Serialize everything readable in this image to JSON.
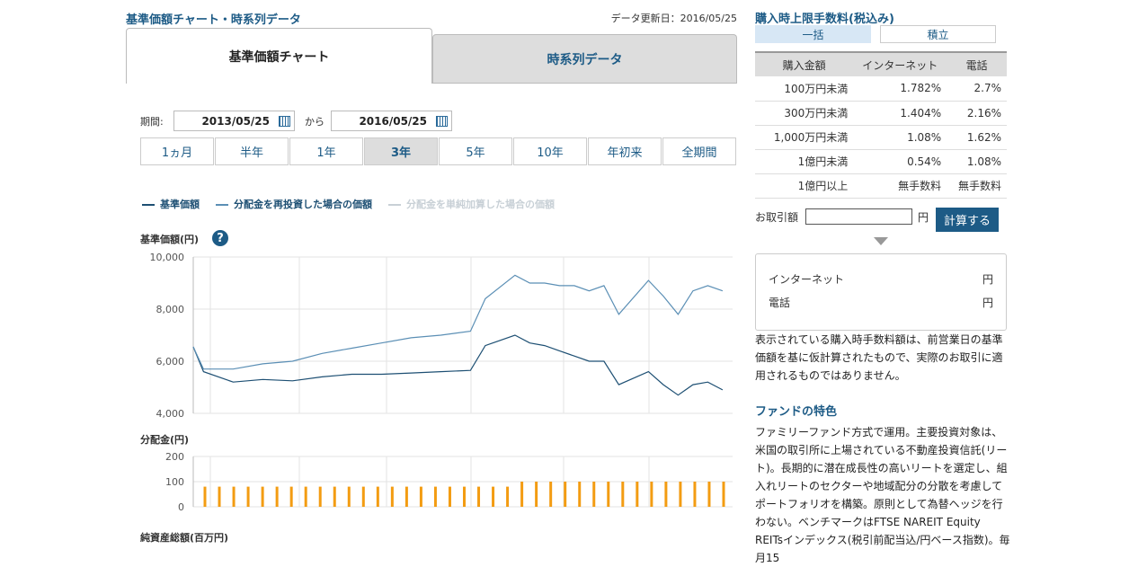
{
  "left": {
    "title": "基準価額チャート・時系列データ",
    "updated": "データ更新日：2016/05/25",
    "tabs": [
      {
        "label": "基準価額チャート"
      },
      {
        "label": "時系列データ"
      }
    ],
    "period_label": "期間:",
    "from_date": "2013/05/25",
    "to_label": "から",
    "to_date": "2016/05/25",
    "periods": [
      "1ヵ月",
      "半年",
      "1年",
      "3年",
      "5年",
      "10年",
      "年初来",
      "全期間"
    ],
    "selected_period": "3年",
    "legend": [
      "基準価額",
      "分配金を再投資した場合の価額",
      "分配金を単純加算した場合の価額"
    ],
    "price_axis_title": "基準価額(円)",
    "help_icon": "?",
    "dist_axis_title": "分配金(円)",
    "bottom_title": "純資産総額(百万円)"
  },
  "colors": {
    "nav": "#1d4f73",
    "reinvest": "#5b8fb5",
    "simple": "#c8d0d6",
    "bar": "#f39c12",
    "accent": "#1d5b86"
  },
  "chart_data": [
    {
      "type": "line",
      "title": "",
      "ylabel": "基準価額(円)",
      "ylim": [
        4000,
        10000
      ],
      "yticks": [
        "10,000",
        "8,000",
        "6,000",
        "4,000"
      ],
      "x_range": [
        "2013/05/25",
        "2016/05/25"
      ],
      "series": [
        {
          "name": "基準価額",
          "x": [
            "2013/05",
            "2013/06",
            "2013/08",
            "2013/10",
            "2013/12",
            "2014/02",
            "2014/04",
            "2014/06",
            "2014/08",
            "2014/10",
            "2014/12",
            "2015/01",
            "2015/03",
            "2015/04",
            "2015/05",
            "2015/06",
            "2015/07",
            "2015/08",
            "2015/09",
            "2015/10",
            "2015/12",
            "2016/01",
            "2016/02",
            "2016/03",
            "2016/04",
            "2016/05"
          ],
          "values": [
            6550,
            5600,
            5200,
            5300,
            5250,
            5400,
            5500,
            5500,
            5550,
            5600,
            5650,
            6600,
            7000,
            6700,
            6600,
            6400,
            6200,
            6000,
            6000,
            5100,
            5600,
            5100,
            4700,
            5100,
            5200,
            4900
          ]
        },
        {
          "name": "分配金を再投資した場合の価額",
          "x": [
            "2013/05",
            "2013/06",
            "2013/08",
            "2013/10",
            "2013/12",
            "2014/02",
            "2014/04",
            "2014/06",
            "2014/08",
            "2014/10",
            "2014/12",
            "2015/01",
            "2015/03",
            "2015/04",
            "2015/05",
            "2015/06",
            "2015/07",
            "2015/08",
            "2015/09",
            "2015/10",
            "2015/12",
            "2016/01",
            "2016/02",
            "2016/03",
            "2016/04",
            "2016/05"
          ],
          "values": [
            6550,
            5700,
            5700,
            5900,
            6000,
            6300,
            6500,
            6700,
            6900,
            7000,
            7150,
            8400,
            9300,
            9000,
            9000,
            8900,
            8900,
            8700,
            8900,
            7800,
            9100,
            8500,
            7800,
            8700,
            8900,
            8700
          ]
        }
      ]
    },
    {
      "type": "bar",
      "title": "",
      "ylabel": "分配金(円)",
      "ylim": [
        0,
        200
      ],
      "yticks": [
        "200",
        "100",
        "0"
      ],
      "values": [
        80,
        80,
        80,
        80,
        80,
        80,
        80,
        80,
        80,
        80,
        80,
        80,
        80,
        80,
        80,
        80,
        80,
        80,
        80,
        80,
        80,
        80,
        100,
        100,
        100,
        100,
        100,
        100,
        100,
        100,
        100,
        100,
        100,
        100,
        100,
        100,
        100
      ]
    }
  ],
  "right": {
    "title": "購入時上限手数料(税込み)",
    "tabs": [
      "一括",
      "積立"
    ],
    "table": {
      "headers": [
        "購入金額",
        "インターネット",
        "電話"
      ],
      "rows": [
        [
          "100万円未満",
          "1.782%",
          "2.7%"
        ],
        [
          "300万円未満",
          "1.404%",
          "2.16%"
        ],
        [
          "1,000万円未満",
          "1.08%",
          "1.62%"
        ],
        [
          "1億円未満",
          "0.54%",
          "1.08%"
        ],
        [
          "1億円以上",
          "無手数料",
          "無手数料"
        ]
      ]
    },
    "amount_label": "お取引額",
    "yen": "円",
    "calc_button": "計算する",
    "result_internet": "インターネット",
    "result_phone": "電話",
    "note": "表示されている購入時手数料額は、前営業日の基準価額を基に仮計算されたもので、実際のお取引に適用されるものではありません。",
    "feature_title": "ファンドの特色",
    "feature_text": "ファミリーファンド方式で運用。主要投資対象は、米国の取引所に上場されている不動産投資信託(リート)。長期的に潜在成長性の高いリートを選定し、組入れリートのセクターや地域配分の分散を考慮してポートフォリオを構築。原則として為替ヘッジを行わない。ベンチマークはFTSE NAREIT Equity REITsインデックス(税引前配当込/円ベース指数)。毎月15"
  }
}
